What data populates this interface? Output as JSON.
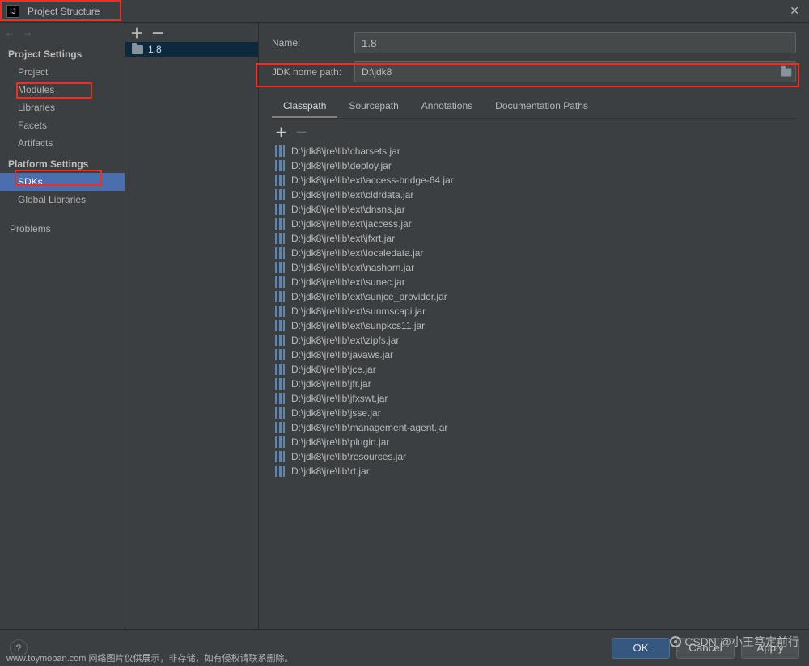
{
  "window": {
    "title": "Project Structure"
  },
  "nav": {
    "cat1": "Project Settings",
    "cat2": "Platform Settings",
    "items": {
      "project": "Project",
      "modules": "Modules",
      "libraries": "Libraries",
      "facets": "Facets",
      "artifacts": "Artifacts",
      "sdks": "SDKs",
      "global_libs": "Global Libraries",
      "problems": "Problems"
    }
  },
  "sdk_list": {
    "0": {
      "label": "1.8"
    }
  },
  "form": {
    "name_label": "Name:",
    "name_value": "1.8",
    "path_label": "JDK home path:",
    "path_value": "D:\\jdk8"
  },
  "tabs": {
    "classpath": "Classpath",
    "sourcepath": "Sourcepath",
    "annotations": "Annotations",
    "docpaths": "Documentation Paths"
  },
  "jars": [
    "D:\\jdk8\\jre\\lib\\charsets.jar",
    "D:\\jdk8\\jre\\lib\\deploy.jar",
    "D:\\jdk8\\jre\\lib\\ext\\access-bridge-64.jar",
    "D:\\jdk8\\jre\\lib\\ext\\cldrdata.jar",
    "D:\\jdk8\\jre\\lib\\ext\\dnsns.jar",
    "D:\\jdk8\\jre\\lib\\ext\\jaccess.jar",
    "D:\\jdk8\\jre\\lib\\ext\\jfxrt.jar",
    "D:\\jdk8\\jre\\lib\\ext\\localedata.jar",
    "D:\\jdk8\\jre\\lib\\ext\\nashorn.jar",
    "D:\\jdk8\\jre\\lib\\ext\\sunec.jar",
    "D:\\jdk8\\jre\\lib\\ext\\sunjce_provider.jar",
    "D:\\jdk8\\jre\\lib\\ext\\sunmscapi.jar",
    "D:\\jdk8\\jre\\lib\\ext\\sunpkcs11.jar",
    "D:\\jdk8\\jre\\lib\\ext\\zipfs.jar",
    "D:\\jdk8\\jre\\lib\\javaws.jar",
    "D:\\jdk8\\jre\\lib\\jce.jar",
    "D:\\jdk8\\jre\\lib\\jfr.jar",
    "D:\\jdk8\\jre\\lib\\jfxswt.jar",
    "D:\\jdk8\\jre\\lib\\jsse.jar",
    "D:\\jdk8\\jre\\lib\\management-agent.jar",
    "D:\\jdk8\\jre\\lib\\plugin.jar",
    "D:\\jdk8\\jre\\lib\\resources.jar",
    "D:\\jdk8\\jre\\lib\\rt.jar"
  ],
  "buttons": {
    "ok": "OK",
    "cancel": "Cancel",
    "apply": "Apply"
  },
  "watermark": "CSDN @小王笃定前行",
  "footnote": "www.toymoban.com 网络图片仅供展示，非存储，如有侵权请联系删除。"
}
